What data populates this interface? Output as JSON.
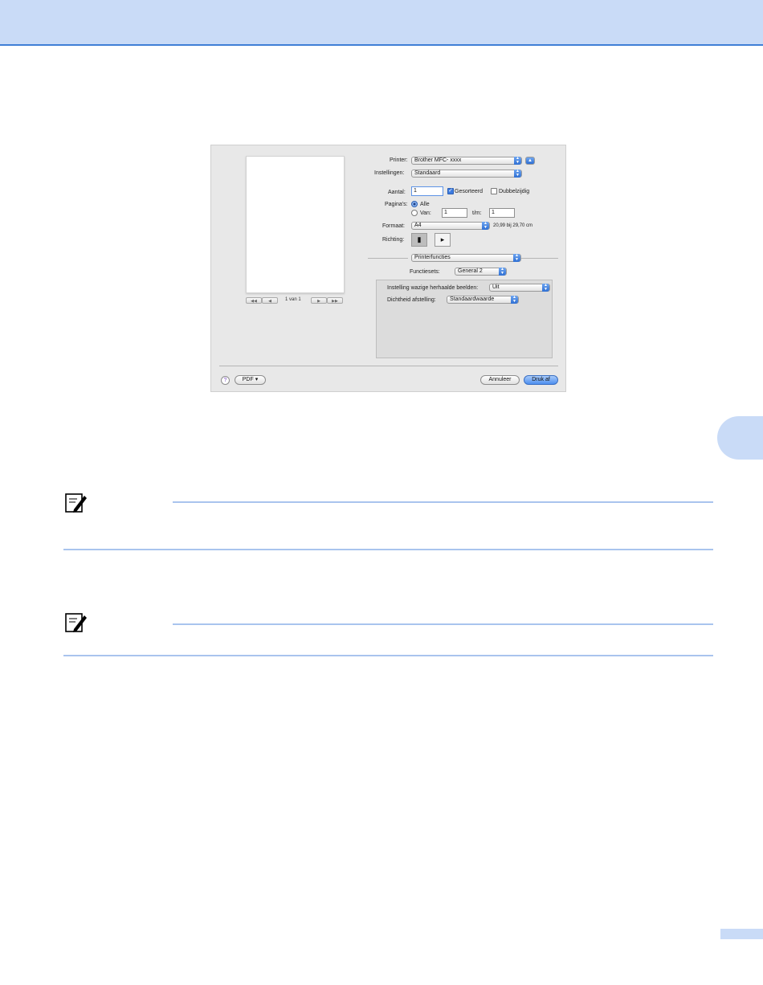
{
  "dialog": {
    "preview": {
      "page_indicator": "1 van 1",
      "nav": [
        "◀◀",
        "◀",
        "▶",
        "▶▶"
      ]
    },
    "printer": {
      "label": "Printer:",
      "value": "Brother MFC- xxxx"
    },
    "presets": {
      "label": "Instellingen:",
      "value": "Standaard"
    },
    "copies": {
      "label": "Aantal:",
      "value": "1",
      "collated_label": "Gesorteerd",
      "collated_checked": true,
      "duplex_label": "Dubbelzijdig",
      "duplex_checked": false
    },
    "pages": {
      "label": "Pagina's:",
      "all_label": "Alle",
      "from_label": "Van:",
      "from_value": "1",
      "to_label": "t/m:",
      "to_value": "1",
      "selected": "Alle"
    },
    "paper_size": {
      "label": "Formaat:",
      "value": "A4",
      "dimensions": "20,99 bij 29,70 cm"
    },
    "orientation": {
      "label": "Richting:",
      "selected": "portrait"
    },
    "panel_popup": {
      "value": "Printerfuncties"
    },
    "feature_sets": {
      "label": "Functiesets:",
      "value": "General 2"
    },
    "settings": [
      {
        "label": "Instelling wazige herhaalde beelden:",
        "value": "Uit"
      },
      {
        "label": "Dichtheid afstelling:",
        "value": "Standaardwaarde"
      }
    ],
    "footer": {
      "help": "?",
      "pdf_label": "PDF ▾",
      "cancel_label": "Annuleer",
      "print_label": "Druk af"
    }
  },
  "colors": {
    "accent": "#3f7fd6",
    "band": "#c9dbf7",
    "note_rule": "#a9c4ee"
  },
  "icons": [
    "note-icon",
    "help-icon",
    "portrait-icon",
    "landscape-icon"
  ]
}
